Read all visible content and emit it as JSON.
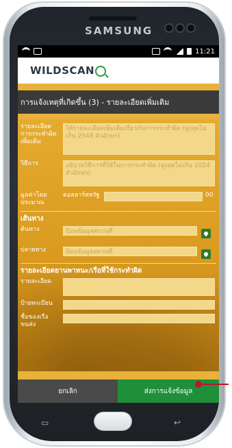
{
  "device": {
    "brand": "SAMSUNG"
  },
  "statusbar": {
    "time": "11:21"
  },
  "app": {
    "logo": "WILDSCAN"
  },
  "page": {
    "title": "การแจ้งเหตุที่เกิดขึ้น (3) - รายละเอียดเพิ่มเติม"
  },
  "form": {
    "detail_label": "รายละเอียดการกระทำผิดเพิ่มเติม",
    "detail_placeholder": "ให้รายละเอียดเพิ่มเติมเกี่ยวกับการกระทำผิด (สูงสุดไม่เกิน 2048 ตัวอักษร)",
    "method_label": "วิธีการ",
    "method_placeholder": "อธิบายวิธีการที่ใช้ในการกระทำผิด (สูงสุดไม่เกิน 1024 ตัวอักษร)",
    "value_label": "มูลค่าโดยประมาณ",
    "currency": "ดอลลาร์สหรัฐ",
    "value_cents": "00",
    "route_section": "เส้นทาง",
    "origin_label": "ต้นทาง",
    "origin_placeholder": "ป้อนข้อมูลสถานที่",
    "destination_label": "ปลายทาง",
    "destination_placeholder": "ป้อนข้อมูลสถานที่",
    "vehicle_section": "รายละเอียดยานพาหนะ/เรือที่ใช้กระทำผิด",
    "vehicle_detail_label": "รายละเอียด",
    "plate_label": "ป้ายทะเบียน",
    "vessel_label": "ชื่อของเรือขนส่ง"
  },
  "actions": {
    "cancel": "ยกเลิก",
    "submit": "ส่งการแจ้งข้อมูล"
  },
  "colors": {
    "form_bg": "#e5ab2f",
    "titlebar": "#3a3a3a",
    "submit": "#1f8f3a",
    "cancel": "#4a4a4a",
    "pointer": "#c0152b"
  },
  "icons": [
    "wifi-icon",
    "signal-icon",
    "battery-icon",
    "location-pin-icon"
  ]
}
